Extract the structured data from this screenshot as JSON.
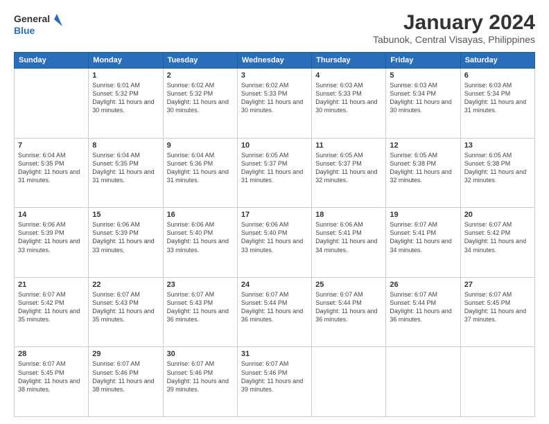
{
  "header": {
    "logo_line1": "General",
    "logo_line2": "Blue",
    "title": "January 2024",
    "subtitle": "Tabunok, Central Visayas, Philippines"
  },
  "calendar": {
    "weekdays": [
      "Sunday",
      "Monday",
      "Tuesday",
      "Wednesday",
      "Thursday",
      "Friday",
      "Saturday"
    ],
    "weeks": [
      [
        {
          "day": "",
          "sunrise": "",
          "sunset": "",
          "daylight": ""
        },
        {
          "day": "1",
          "sunrise": "Sunrise: 6:01 AM",
          "sunset": "Sunset: 5:32 PM",
          "daylight": "Daylight: 11 hours and 30 minutes."
        },
        {
          "day": "2",
          "sunrise": "Sunrise: 6:02 AM",
          "sunset": "Sunset: 5:32 PM",
          "daylight": "Daylight: 11 hours and 30 minutes."
        },
        {
          "day": "3",
          "sunrise": "Sunrise: 6:02 AM",
          "sunset": "Sunset: 5:33 PM",
          "daylight": "Daylight: 11 hours and 30 minutes."
        },
        {
          "day": "4",
          "sunrise": "Sunrise: 6:03 AM",
          "sunset": "Sunset: 5:33 PM",
          "daylight": "Daylight: 11 hours and 30 minutes."
        },
        {
          "day": "5",
          "sunrise": "Sunrise: 6:03 AM",
          "sunset": "Sunset: 5:34 PM",
          "daylight": "Daylight: 11 hours and 30 minutes."
        },
        {
          "day": "6",
          "sunrise": "Sunrise: 6:03 AM",
          "sunset": "Sunset: 5:34 PM",
          "daylight": "Daylight: 11 hours and 31 minutes."
        }
      ],
      [
        {
          "day": "7",
          "sunrise": "Sunrise: 6:04 AM",
          "sunset": "Sunset: 5:35 PM",
          "daylight": "Daylight: 11 hours and 31 minutes."
        },
        {
          "day": "8",
          "sunrise": "Sunrise: 6:04 AM",
          "sunset": "Sunset: 5:35 PM",
          "daylight": "Daylight: 11 hours and 31 minutes."
        },
        {
          "day": "9",
          "sunrise": "Sunrise: 6:04 AM",
          "sunset": "Sunset: 5:36 PM",
          "daylight": "Daylight: 11 hours and 31 minutes."
        },
        {
          "day": "10",
          "sunrise": "Sunrise: 6:05 AM",
          "sunset": "Sunset: 5:37 PM",
          "daylight": "Daylight: 11 hours and 31 minutes."
        },
        {
          "day": "11",
          "sunrise": "Sunrise: 6:05 AM",
          "sunset": "Sunset: 5:37 PM",
          "daylight": "Daylight: 11 hours and 32 minutes."
        },
        {
          "day": "12",
          "sunrise": "Sunrise: 6:05 AM",
          "sunset": "Sunset: 5:38 PM",
          "daylight": "Daylight: 11 hours and 32 minutes."
        },
        {
          "day": "13",
          "sunrise": "Sunrise: 6:05 AM",
          "sunset": "Sunset: 5:38 PM",
          "daylight": "Daylight: 11 hours and 32 minutes."
        }
      ],
      [
        {
          "day": "14",
          "sunrise": "Sunrise: 6:06 AM",
          "sunset": "Sunset: 5:39 PM",
          "daylight": "Daylight: 11 hours and 33 minutes."
        },
        {
          "day": "15",
          "sunrise": "Sunrise: 6:06 AM",
          "sunset": "Sunset: 5:39 PM",
          "daylight": "Daylight: 11 hours and 33 minutes."
        },
        {
          "day": "16",
          "sunrise": "Sunrise: 6:06 AM",
          "sunset": "Sunset: 5:40 PM",
          "daylight": "Daylight: 11 hours and 33 minutes."
        },
        {
          "day": "17",
          "sunrise": "Sunrise: 6:06 AM",
          "sunset": "Sunset: 5:40 PM",
          "daylight": "Daylight: 11 hours and 33 minutes."
        },
        {
          "day": "18",
          "sunrise": "Sunrise: 6:06 AM",
          "sunset": "Sunset: 5:41 PM",
          "daylight": "Daylight: 11 hours and 34 minutes."
        },
        {
          "day": "19",
          "sunrise": "Sunrise: 6:07 AM",
          "sunset": "Sunset: 5:41 PM",
          "daylight": "Daylight: 11 hours and 34 minutes."
        },
        {
          "day": "20",
          "sunrise": "Sunrise: 6:07 AM",
          "sunset": "Sunset: 5:42 PM",
          "daylight": "Daylight: 11 hours and 34 minutes."
        }
      ],
      [
        {
          "day": "21",
          "sunrise": "Sunrise: 6:07 AM",
          "sunset": "Sunset: 5:42 PM",
          "daylight": "Daylight: 11 hours and 35 minutes."
        },
        {
          "day": "22",
          "sunrise": "Sunrise: 6:07 AM",
          "sunset": "Sunset: 5:43 PM",
          "daylight": "Daylight: 11 hours and 35 minutes."
        },
        {
          "day": "23",
          "sunrise": "Sunrise: 6:07 AM",
          "sunset": "Sunset: 5:43 PM",
          "daylight": "Daylight: 11 hours and 36 minutes."
        },
        {
          "day": "24",
          "sunrise": "Sunrise: 6:07 AM",
          "sunset": "Sunset: 5:44 PM",
          "daylight": "Daylight: 11 hours and 36 minutes."
        },
        {
          "day": "25",
          "sunrise": "Sunrise: 6:07 AM",
          "sunset": "Sunset: 5:44 PM",
          "daylight": "Daylight: 11 hours and 36 minutes."
        },
        {
          "day": "26",
          "sunrise": "Sunrise: 6:07 AM",
          "sunset": "Sunset: 5:44 PM",
          "daylight": "Daylight: 11 hours and 36 minutes."
        },
        {
          "day": "27",
          "sunrise": "Sunrise: 6:07 AM",
          "sunset": "Sunset: 5:45 PM",
          "daylight": "Daylight: 11 hours and 37 minutes."
        }
      ],
      [
        {
          "day": "28",
          "sunrise": "Sunrise: 6:07 AM",
          "sunset": "Sunset: 5:45 PM",
          "daylight": "Daylight: 11 hours and 38 minutes."
        },
        {
          "day": "29",
          "sunrise": "Sunrise: 6:07 AM",
          "sunset": "Sunset: 5:46 PM",
          "daylight": "Daylight: 11 hours and 38 minutes."
        },
        {
          "day": "30",
          "sunrise": "Sunrise: 6:07 AM",
          "sunset": "Sunset: 5:46 PM",
          "daylight": "Daylight: 11 hours and 39 minutes."
        },
        {
          "day": "31",
          "sunrise": "Sunrise: 6:07 AM",
          "sunset": "Sunset: 5:46 PM",
          "daylight": "Daylight: 11 hours and 39 minutes."
        },
        {
          "day": "",
          "sunrise": "",
          "sunset": "",
          "daylight": ""
        },
        {
          "day": "",
          "sunrise": "",
          "sunset": "",
          "daylight": ""
        },
        {
          "day": "",
          "sunrise": "",
          "sunset": "",
          "daylight": ""
        }
      ]
    ]
  }
}
